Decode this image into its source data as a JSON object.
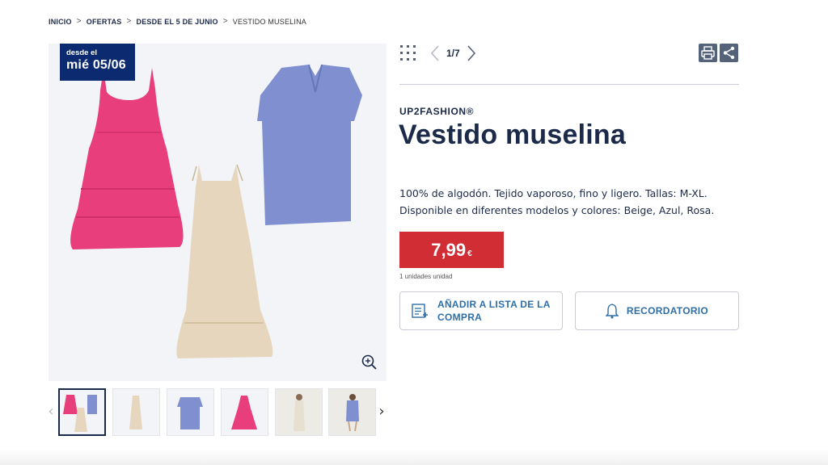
{
  "breadcrumb": [
    {
      "label": "INICIO"
    },
    {
      "label": "OFERTAS"
    },
    {
      "label": "DESDE EL 5 DE JUNIO"
    },
    {
      "label": "VESTIDO MUSELINA"
    }
  ],
  "badge": {
    "line1": "desde el",
    "line2": "mié 05/06"
  },
  "pager": {
    "text": "1/7"
  },
  "product": {
    "brand": "UP2FASHION®",
    "title": "Vestido muselina",
    "description_line1": "100% de algodón. Tejido vaporoso, fino y ligero. Tallas: M-XL.",
    "description_line2": "Disponible en diferentes modelos y colores: Beige, Azul, Rosa.",
    "price": "7,99",
    "currency": "€",
    "units": "1 unidades unidad"
  },
  "buttons": {
    "shopping_list": "AÑADIR A LISTA DE LA COMPRA",
    "reminder": "RECORDATORIO"
  },
  "icons": {
    "grid": "grid-icon",
    "prev": "chevron-left-icon",
    "next": "chevron-right-icon",
    "print": "print-icon",
    "share": "share-icon",
    "zoom": "zoom-in-icon",
    "list": "list-add-icon",
    "bell": "bell-icon"
  },
  "colors": {
    "navy": "#1c2a4a",
    "badge": "#0b2a6f",
    "price": "#d12d35",
    "link": "#2f6fa8",
    "pink_dress": "#e83e7b",
    "beige_dress": "#e6d6bd",
    "blue_dress": "#7f8fd0"
  }
}
